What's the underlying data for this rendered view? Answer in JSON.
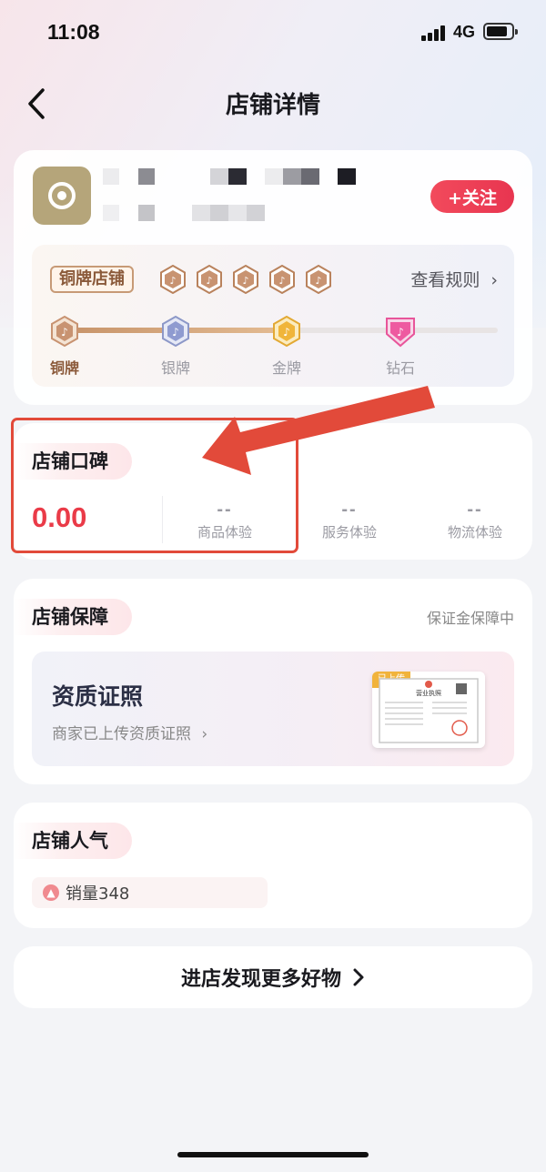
{
  "status_bar": {
    "time": "11:08",
    "network": "4G"
  },
  "header": {
    "title": "店铺详情"
  },
  "shop": {
    "follow_label": "+关注",
    "level_badge": "铜牌店铺",
    "rules_link": "查看规则",
    "levels": [
      {
        "label": "铜牌",
        "icon": "bronze-medal-icon"
      },
      {
        "label": "银牌",
        "icon": "silver-medal-icon"
      },
      {
        "label": "金牌",
        "icon": "gold-medal-icon"
      },
      {
        "label": "钻石",
        "icon": "diamond-medal-icon"
      }
    ],
    "current_level_progress": 0.5
  },
  "reputation": {
    "title": "店铺口碑",
    "score": "0.00",
    "metrics": [
      {
        "value": "--",
        "label": "商品体验"
      },
      {
        "value": "--",
        "label": "服务体验"
      },
      {
        "value": "--",
        "label": "物流体验"
      }
    ]
  },
  "guarantee": {
    "title": "店铺保障",
    "status": "保证金保障中",
    "license_title": "资质证照",
    "license_subtitle": "商家已上传资质证照",
    "uploaded_tag": "已上传",
    "license_heading": "营业执照"
  },
  "popularity": {
    "title": "店铺人气",
    "sales_label": "销量348"
  },
  "enter_store": {
    "label": "进店发现更多好物"
  },
  "colors": {
    "accent_red": "#ea3b48",
    "annotation_red": "#e24a3a",
    "bronze": "#c79369",
    "follow_button": "#f24a5c"
  }
}
